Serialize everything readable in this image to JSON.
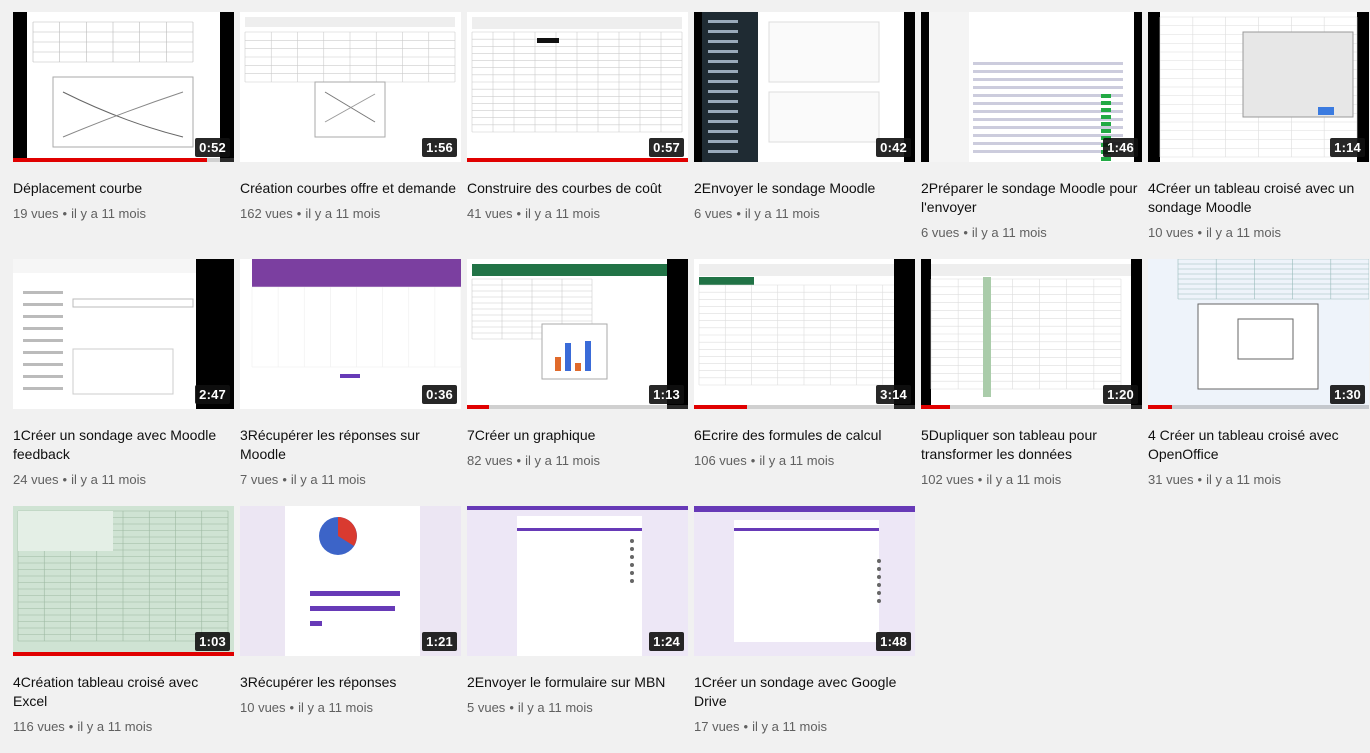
{
  "videos": [
    {
      "title": "Déplacement courbe",
      "views": "19 vues",
      "age": "il y a 11 mois",
      "duration": "0:52",
      "progress": 0.88,
      "thumb": "chart-excel"
    },
    {
      "title": "Création courbes offre et demande",
      "views": "162 vues",
      "age": "il y a 11 mois",
      "duration": "1:56",
      "progress": 0,
      "thumb": "chart-sheet"
    },
    {
      "title": "Construire des courbes de coût",
      "views": "41 vues",
      "age": "il y a 11 mois",
      "duration": "0:57",
      "progress": 1.0,
      "thumb": "sheet"
    },
    {
      "title": "2Envoyer le sondage Moodle",
      "views": "6 vues",
      "age": "il y a 11 mois",
      "duration": "0:42",
      "progress": 0,
      "thumb": "moodle-dark"
    },
    {
      "title": "2Préparer le sondage Moodle pour l'envoyer",
      "views": "6 vues",
      "age": "il y a 11 mois",
      "duration": "1:46",
      "progress": 0,
      "thumb": "moodle-list"
    },
    {
      "title": "4Créer un tableau croisé avec un sondage Moodle",
      "views": "10 vues",
      "age": "il y a 11 mois",
      "duration": "1:14",
      "progress": 0,
      "thumb": "dialog"
    },
    {
      "title": "1Créer un sondage avec Moodle feedback",
      "views": "24 vues",
      "age": "il y a 11 mois",
      "duration": "2:47",
      "progress": 0,
      "thumb": "form"
    },
    {
      "title": "3Récupérer les réponses sur Moodle",
      "views": "7 vues",
      "age": "il y a 11 mois",
      "duration": "0:36",
      "progress": 0,
      "thumb": "purple-chart"
    },
    {
      "title": "7Créer un graphique",
      "views": "82 vues",
      "age": "il y a 11 mois",
      "duration": "1:13",
      "progress": 0.1,
      "thumb": "bar-chart"
    },
    {
      "title": "6Ecrire des formules de calcul",
      "views": "106 vues",
      "age": "il y a 11 mois",
      "duration": "3:14",
      "progress": 0.24,
      "thumb": "sheet-green"
    },
    {
      "title": "5Dupliquer son tableau pour transformer les données",
      "views": "102 vues",
      "age": "il y a 11 mois",
      "duration": "1:20",
      "progress": 0.13,
      "thumb": "sheet-green2"
    },
    {
      "title": "4 Créer un tableau croisé avec OpenOffice",
      "views": "31 vues",
      "age": "il y a 11 mois",
      "duration": "1:30",
      "progress": 0.11,
      "thumb": "openoffice"
    },
    {
      "title": "4Création tableau croisé avec Excel",
      "views": "116 vues",
      "age": "il y a 11 mois",
      "duration": "1:03",
      "progress": 1.0,
      "thumb": "excel-green"
    },
    {
      "title": "3Récupérer les réponses",
      "views": "10 vues",
      "age": "il y a 11 mois",
      "duration": "1:21",
      "progress": 0,
      "thumb": "pie-gform"
    },
    {
      "title": "2Envoyer le formulaire sur MBN",
      "views": "5 vues",
      "age": "il y a 11 mois",
      "duration": "1:24",
      "progress": 0,
      "thumb": "gform"
    },
    {
      "title": "1Créer un sondage avec Google Drive",
      "views": "17 vues",
      "age": "il y a 11 mois",
      "duration": "1:48",
      "progress": 0,
      "thumb": "gform2"
    }
  ],
  "separator": "•",
  "colors": {
    "progress": "#e00000",
    "purple": "#673ab7",
    "excel_green": "#217346"
  }
}
